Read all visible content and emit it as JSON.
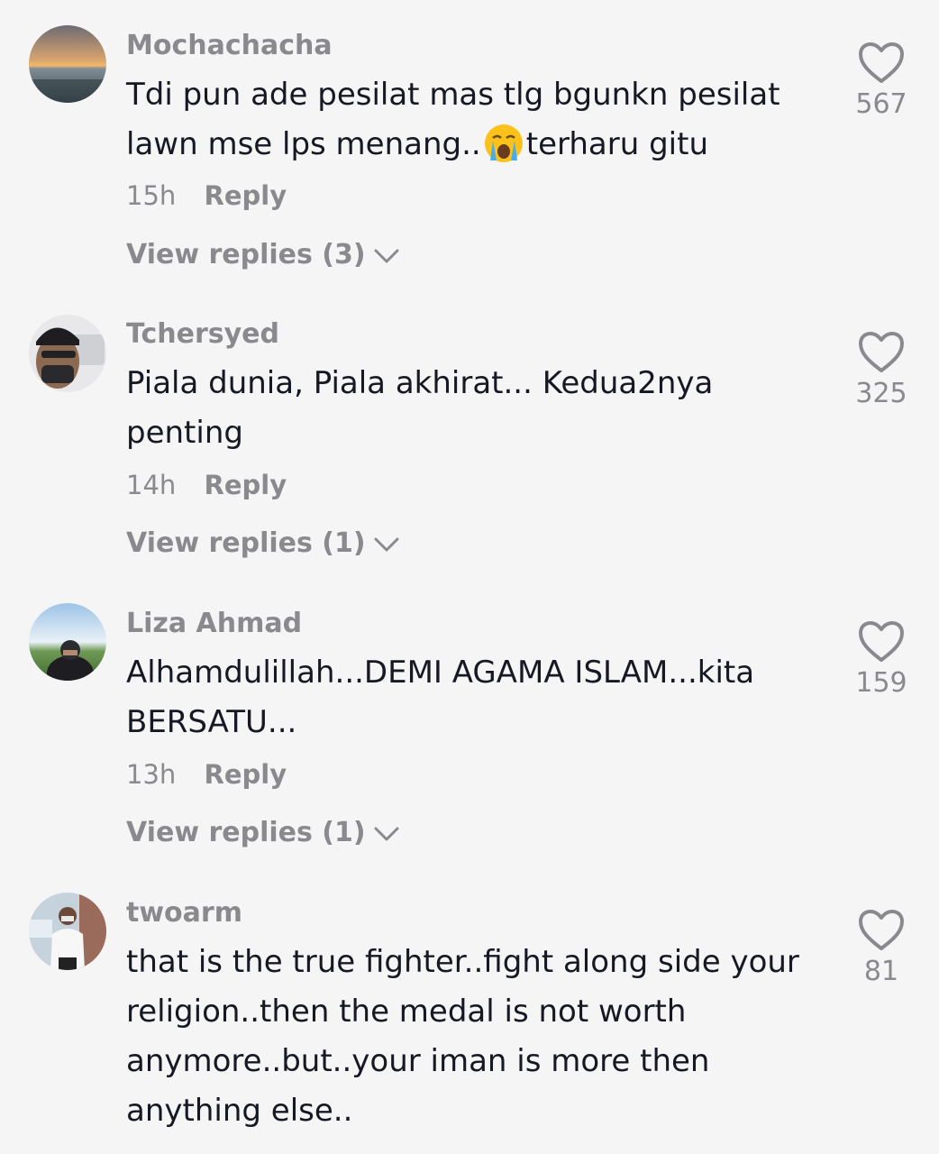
{
  "comments": [
    {
      "username": "Mochachacha",
      "text_part1": "Tdi pun ade pesilat mas tlg bgunkn pesilat lawn mse lps menang..",
      "emoji": "loudly-crying-face-emoji",
      "text_part2": "terharu gitu",
      "time": "15h",
      "reply_label": "Reply",
      "view_replies": "View replies (3)",
      "likes": "567"
    },
    {
      "username": "Tchersyed",
      "text": "Piala dunia, Piala akhirat... Kedua2nya penting",
      "time": "14h",
      "reply_label": "Reply",
      "view_replies": "View replies (1)",
      "likes": "325"
    },
    {
      "username": "Liza Ahmad",
      "text": "Alhamdulillah...DEMI AGAMA ISLAM...kita BERSATU...",
      "time": "13h",
      "reply_label": "Reply",
      "view_replies": "View replies (1)",
      "likes": "159"
    },
    {
      "username": "twoarm",
      "text": "that is the true fighter..fight along side your religion..then the medal is not worth anymore..but..your iman is more then anything else..",
      "likes": "81"
    }
  ],
  "icons": {
    "like": "heart-outline-icon",
    "expand": "chevron-down-icon"
  },
  "colors": {
    "background": "#f5f5f6",
    "primary_text": "#161823",
    "secondary_text": "#8a8a8e"
  }
}
